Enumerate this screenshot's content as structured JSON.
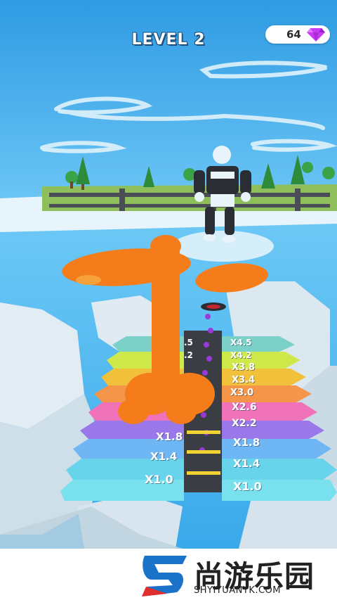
{
  "hud": {
    "level_label": "LEVEL 2",
    "gem_count": "64",
    "gem_icon": "diamond-icon"
  },
  "multipliers": {
    "right": [
      "X4.5",
      "X4.2",
      "X3.8",
      "X3.4",
      "X3.0",
      "X2.6",
      "X2.2",
      "X1.8",
      "X1.4",
      "X1.0"
    ],
    "left": [
      ".5",
      ".2",
      "X1.8",
      "X1.4",
      "X1.0"
    ]
  },
  "colors": {
    "sky": "#35a7e8",
    "balloon": "#f57c1a",
    "gem": "#c73cf2",
    "watermark_accent": "#1a73c9"
  },
  "watermark": {
    "chinese": "尚游乐园",
    "domain": "SHYIYUANYK.COM"
  }
}
